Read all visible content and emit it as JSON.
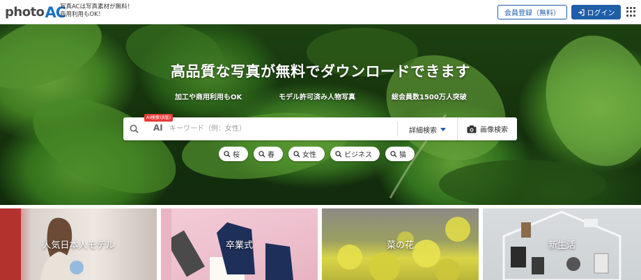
{
  "header": {
    "logo_photo": "photo",
    "logo_ac": "AC",
    "tagline_line1": "写真ACは写真素材が無料！",
    "tagline_line2": "商用利用もOK！",
    "register_label": "会員登録（無料）",
    "login_label": "ログイン"
  },
  "hero": {
    "title": "高品質な写真が無料でダウンロードできます",
    "features": [
      "加工や商用利用もOK",
      "モデル許可済み人物写真",
      "総会員数1500万人突破"
    ],
    "search": {
      "ai_badge": "AI検索(β版)",
      "ai_label": "AI",
      "placeholder": "キーワード（例：女性）",
      "detail_label": "詳細検索",
      "image_search_label": "画像検索"
    },
    "chips": [
      "桜",
      "春",
      "女性",
      "ビジネス",
      "猫"
    ]
  },
  "categories": [
    "人気日本人モデル",
    "卒業式",
    "菜の花",
    "新生活"
  ],
  "colors": {
    "brand_blue": "#1e5da8",
    "ai_red": "#e53935"
  }
}
